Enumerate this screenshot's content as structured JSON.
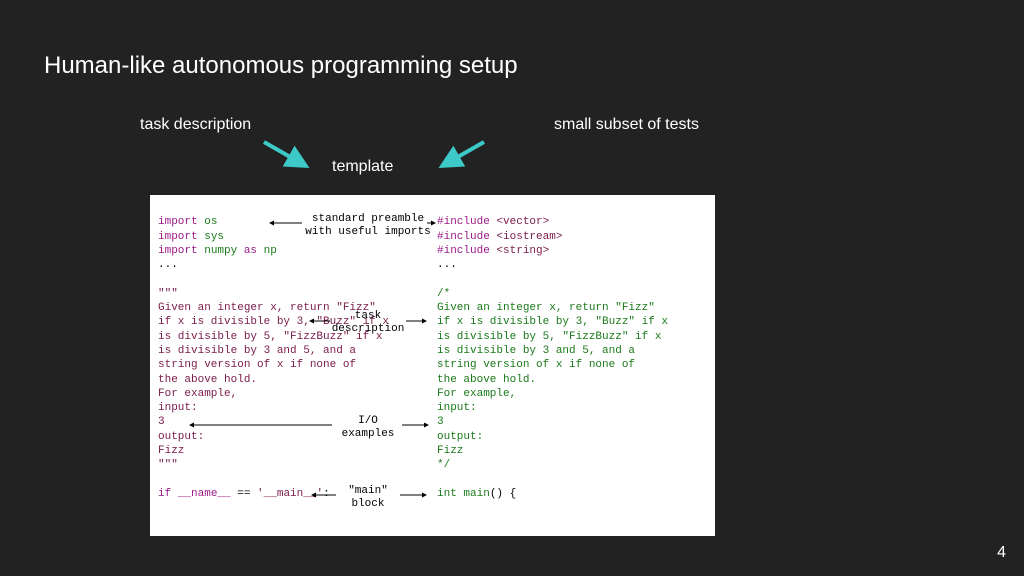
{
  "title": "Human-like autonomous programming setup",
  "labels": {
    "task": "task description",
    "tests": "small subset of tests",
    "template": "template"
  },
  "annotations": {
    "preamble_line1": "standard preamble",
    "preamble_line2": "with useful imports",
    "taskdesc_line1": "task",
    "taskdesc_line2": "description",
    "io_line1": "I/O",
    "io_line2": "examples",
    "main_line1": "\"main\"",
    "main_line2": "block"
  },
  "python": {
    "import1_kw": "import ",
    "import1_mod": "os",
    "import2_kw": "import ",
    "import2_mod": "sys",
    "import3_kw": "import ",
    "import3_mod": "numpy ",
    "import3_as": "as ",
    "import3_alias": "np",
    "ellipsis1": "...",
    "blank1": " ",
    "quote_open": "\"\"\"",
    "desc_l1": "Given an integer x, return \"Fizz\"",
    "desc_l2": "if x is divisible by 3, \"Buzz\" if x",
    "desc_l3": "is divisible by 5, \"FizzBuzz\" if x",
    "desc_l4": "is divisible by 3 and 5, and a",
    "desc_l5": "string version of x if none of",
    "desc_l6": "the above hold.",
    "desc_l7": "For example,",
    "desc_l8": "input:",
    "desc_l9": "3",
    "desc_l10": "output:",
    "desc_l11": "Fizz",
    "quote_close": "\"\"\"",
    "blank2": " ",
    "main_if": "if ",
    "main_name": "__name__ ",
    "main_eq": "== ",
    "main_str": "'__main__'",
    "main_colon": ":"
  },
  "cpp": {
    "inc1_pre": "#include ",
    "inc1_hdr": "<vector>",
    "inc2_pre": "#include ",
    "inc2_hdr": "<iostream>",
    "inc3_pre": "#include ",
    "inc3_hdr": "<string>",
    "ellipsis1": "...",
    "blank1": " ",
    "comment_open": "/*",
    "desc_l1": "Given an integer x, return \"Fizz\"",
    "desc_l2": "if x is divisible by 3, \"Buzz\" if x",
    "desc_l3": "is divisible by 5, \"FizzBuzz\" if x",
    "desc_l4": "is divisible by 3 and 5, and a",
    "desc_l5": "string version of x if none of",
    "desc_l6": "the above hold.",
    "desc_l7": "For example,",
    "desc_l8": "input:",
    "desc_l9": "3",
    "desc_l10": "output:",
    "desc_l11": "Fizz",
    "comment_close": "*/",
    "blank2": " ",
    "main_decl": "int main",
    "main_paren": "() {"
  },
  "pageNumber": "4"
}
